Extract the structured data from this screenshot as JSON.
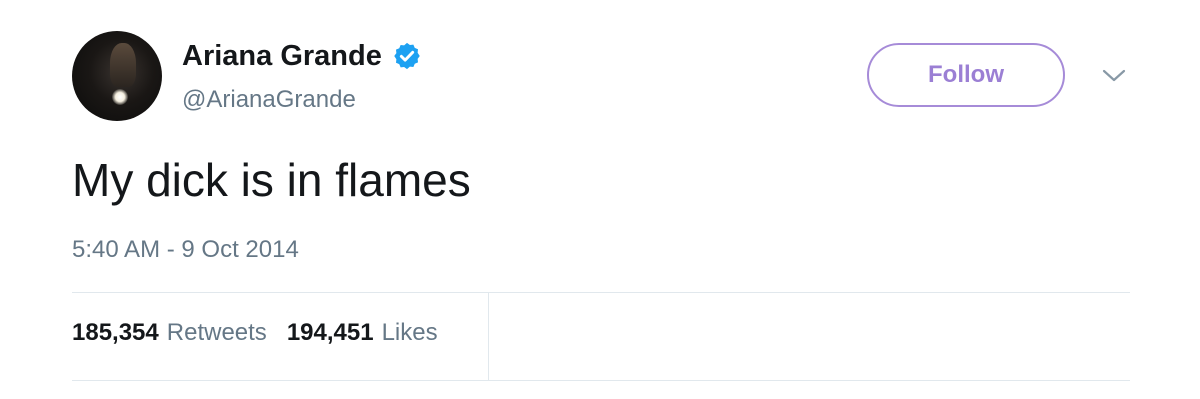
{
  "tweet": {
    "author": {
      "display_name": "Ariana Grande",
      "handle": "@ArianaGrande",
      "verified": true,
      "verified_icon": "verified-badge-icon",
      "avatar_icon": "profile-avatar"
    },
    "follow_label": "Follow",
    "menu_icon": "chevron-down-icon",
    "text": "My dick is in flames",
    "timestamp": "5:40 AM - 9 Oct 2014",
    "stats": {
      "retweets_count": "185,354",
      "retweets_label": "Retweets",
      "likes_count": "194,451",
      "likes_label": "Likes"
    }
  },
  "colors": {
    "accent_follow": "#9b7fd4",
    "verified_blue": "#1da1f2",
    "secondary_text": "#657786",
    "primary_text": "#14171a",
    "divider": "#e1e8ed"
  }
}
